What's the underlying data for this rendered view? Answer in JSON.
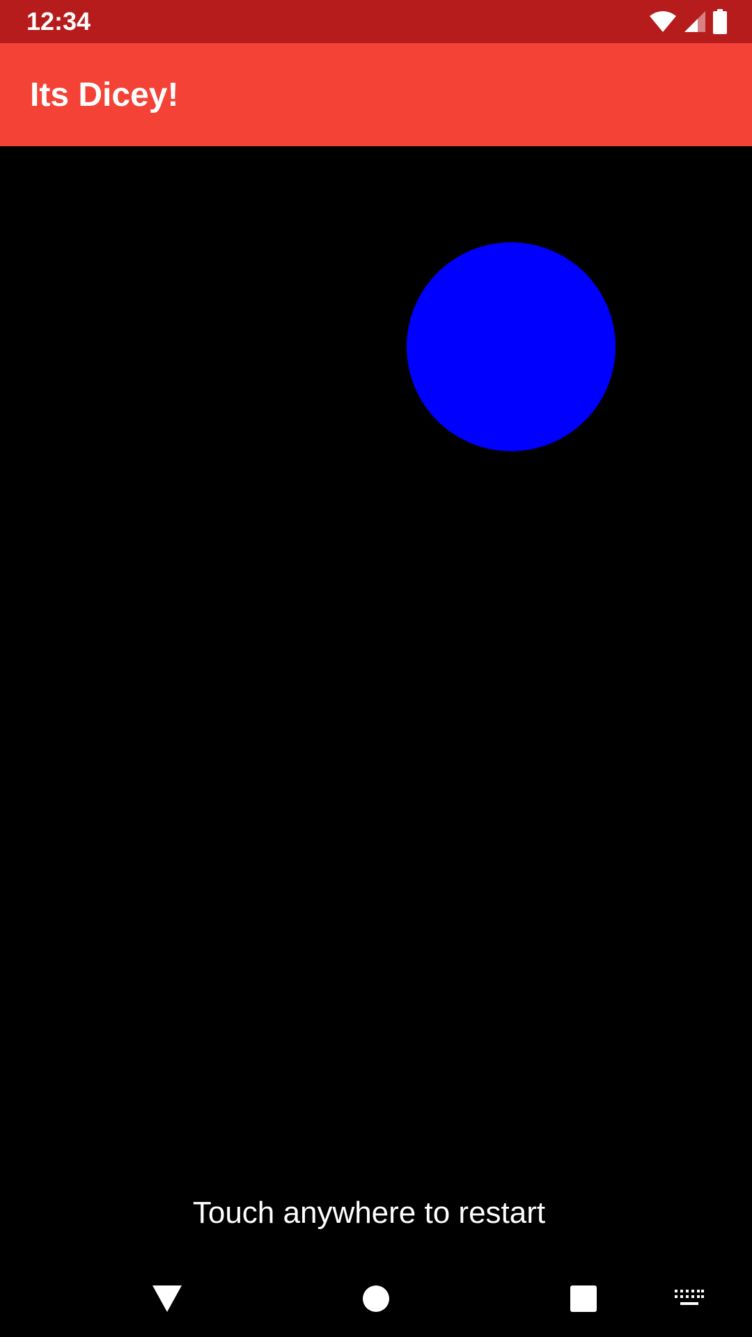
{
  "status_bar": {
    "time": "12:34",
    "icons": [
      "wifi-icon",
      "cellular-signal-icon",
      "battery-icon"
    ],
    "color": "#B71C1C"
  },
  "app_bar": {
    "title": "Its Dicey!",
    "color": "#F44336"
  },
  "game": {
    "ball_color": "#0000FF",
    "background_color": "#000000",
    "restart_hint": "Touch anywhere to restart"
  },
  "nav_bar": {
    "icons": [
      "back-icon",
      "home-icon",
      "recents-icon",
      "keyboard-icon"
    ]
  }
}
